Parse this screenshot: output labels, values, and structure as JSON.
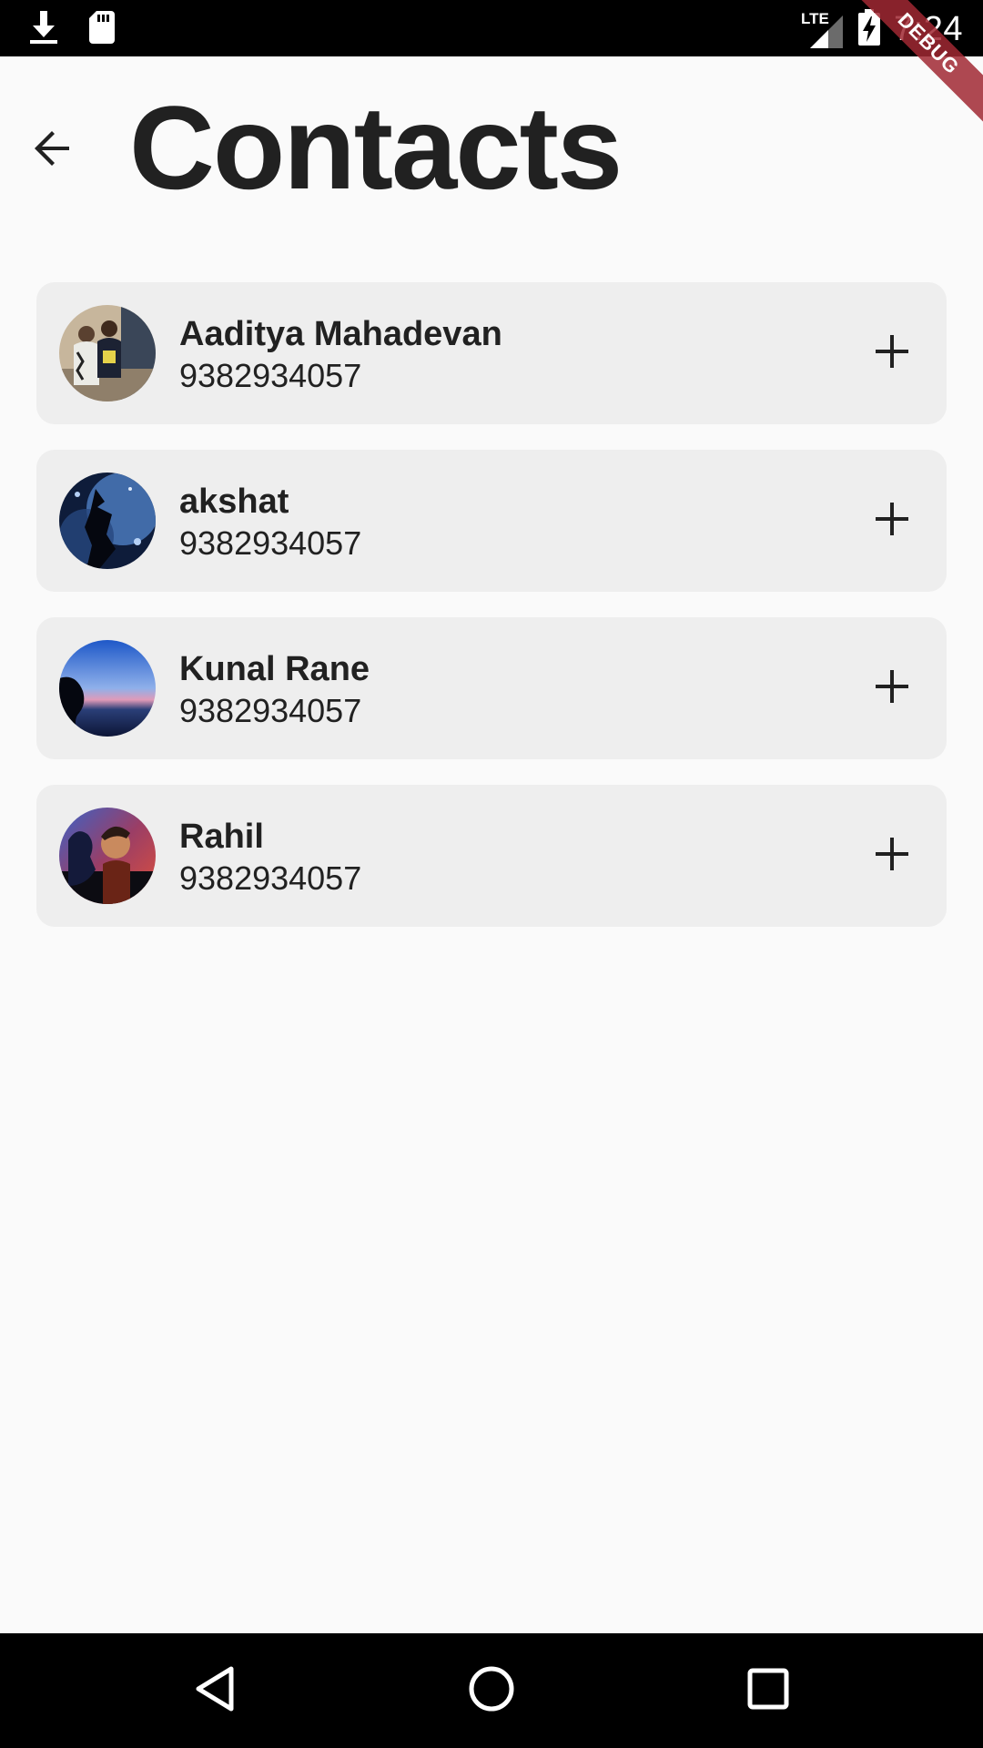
{
  "status_bar": {
    "time": "7:24",
    "network": "LTE",
    "icons": [
      "download-icon",
      "sd-card-icon",
      "lte-signal-icon",
      "battery-charging-icon"
    ]
  },
  "debug_banner": "DEBUG",
  "header": {
    "back_icon": "arrow-back-icon",
    "title": "Contacts"
  },
  "contacts": [
    {
      "name": "Aaditya Mahadevan",
      "phone": "9382934057",
      "action_icon": "add-icon"
    },
    {
      "name": "akshat",
      "phone": "9382934057",
      "action_icon": "add-icon"
    },
    {
      "name": "Kunal Rane",
      "phone": "9382934057",
      "action_icon": "add-icon"
    },
    {
      "name": "Rahil",
      "phone": "9382934057",
      "action_icon": "add-icon"
    }
  ],
  "nav_bar": {
    "icons": [
      "back-triangle-icon",
      "home-circle-icon",
      "recents-square-icon"
    ]
  },
  "colors": {
    "background": "#fafafa",
    "card": "#eeeeee",
    "text": "#212121",
    "bars": "#000000",
    "debug_ribbon": "#a02832"
  }
}
